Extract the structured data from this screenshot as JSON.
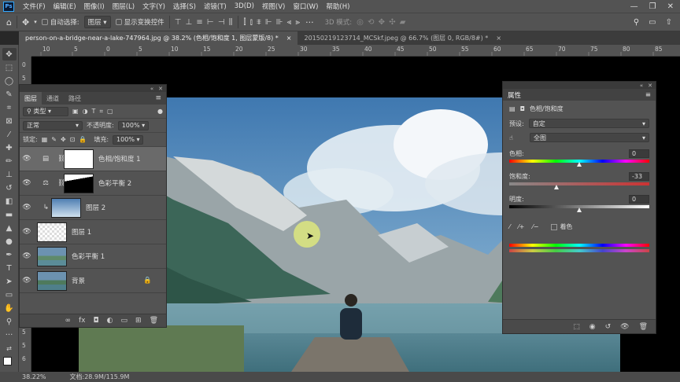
{
  "menu": {
    "logo": "Ps",
    "items": [
      "文件(F)",
      "编辑(E)",
      "图像(I)",
      "图层(L)",
      "文字(Y)",
      "选择(S)",
      "滤镜(T)",
      "3D(D)",
      "视图(V)",
      "窗口(W)",
      "帮助(H)"
    ]
  },
  "options": {
    "auto_select_label": "自动选择:",
    "auto_select_value": "图层",
    "transform_label": "显示变换控件",
    "mode_3d": "3D 模式:",
    "more": "···"
  },
  "doc_tabs": [
    {
      "label": "person-on-a-bridge-near-a-lake-747964.jpg @ 38.2% (色相/饱和度 1, 图层蒙版/8) *",
      "close": "×"
    },
    {
      "label": "20150219123714_MCSkf.jpeg @ 66.7% (图层 0, RGB/8#) *",
      "close": "×"
    }
  ],
  "ruler_h": [
    "10",
    "5",
    "0",
    "5",
    "10",
    "15",
    "20",
    "25",
    "30",
    "35",
    "40",
    "45",
    "50",
    "55",
    "60",
    "65",
    "70",
    "75",
    "80",
    "85"
  ],
  "ruler_v": [
    "0",
    "5",
    "1",
    "0",
    "1",
    "5",
    "2",
    "0",
    "2",
    "5",
    "3",
    "0",
    "3",
    "5",
    "4",
    "0",
    "4",
    "5",
    "5",
    "0",
    "5",
    "5",
    "6"
  ],
  "layers_panel": {
    "tabs": [
      "图层",
      "通道",
      "路径"
    ],
    "filter_label": "类型",
    "blend_mode": "正常",
    "opacity_label": "不透明度:",
    "opacity_value": "100%",
    "lock_label": "锁定:",
    "fill_label": "填充:",
    "fill_value": "100%",
    "layers": [
      {
        "name": "色相/饱和度 1",
        "type": "adjustment",
        "selected": true
      },
      {
        "name": "色彩平衡 2",
        "type": "adjustment",
        "selected": false
      },
      {
        "name": "图层 2",
        "type": "clipped",
        "selected": false
      },
      {
        "name": "图层 1",
        "type": "pixel",
        "selected": false
      },
      {
        "name": "色彩平衡 1",
        "type": "pixel",
        "selected": false
      },
      {
        "name": "背景",
        "type": "background",
        "selected": false
      }
    ],
    "footer": [
      "∞",
      "fx",
      "◘",
      "◐",
      "▭",
      "⊞",
      "🗑"
    ]
  },
  "properties_panel": {
    "title": "属性",
    "header": "色相/饱和度",
    "preset_label": "预设:",
    "preset_value": "自定",
    "channel_value": "全图",
    "hue_label": "色相:",
    "hue_value": "0",
    "sat_label": "饱和度:",
    "sat_value": "-33",
    "light_label": "明度:",
    "light_value": "0",
    "colorize_label": "着色",
    "hue_pct": 0.5,
    "sat_pct": 0.335,
    "light_pct": 0.5
  },
  "status": {
    "zoom": "38.22%",
    "doc": "文档:28.9M/115.9M"
  },
  "colors": {
    "accent": "#31a8ff",
    "panel": "#535353",
    "dark": "#3a3a3a"
  }
}
